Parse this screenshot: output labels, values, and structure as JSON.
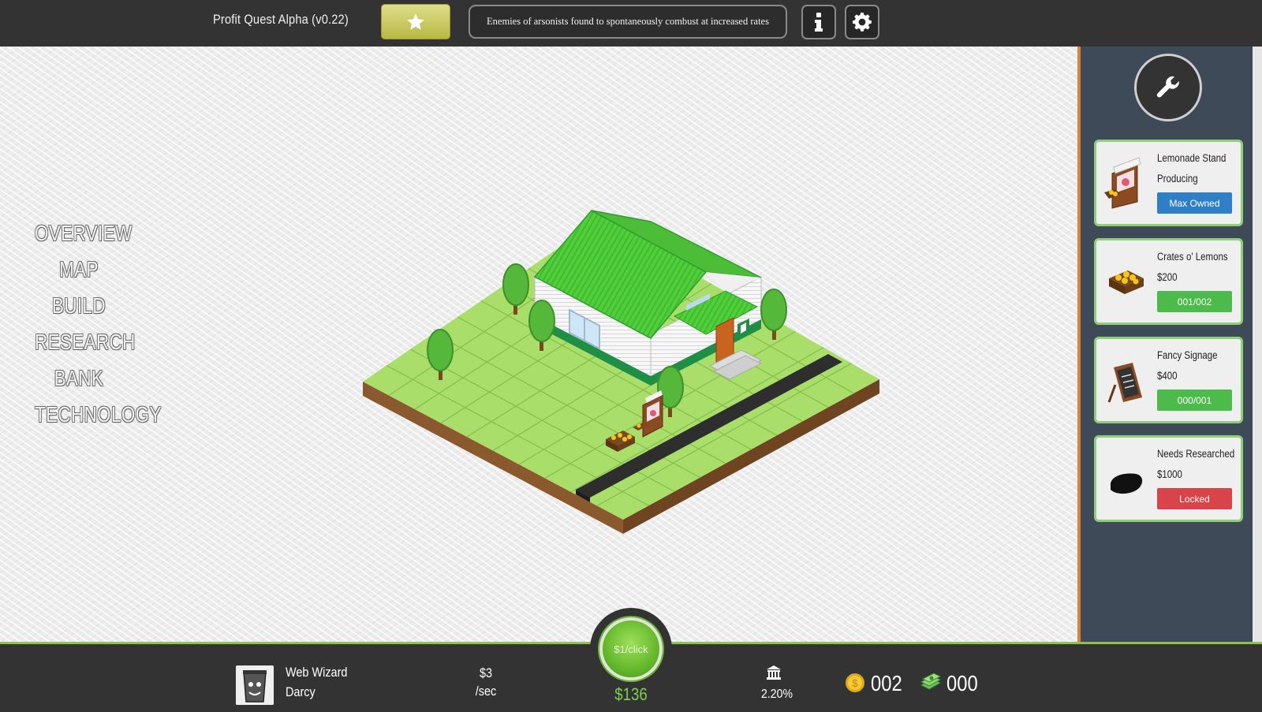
{
  "header": {
    "title": "Profit Quest Alpha (v0.22)",
    "ticker": "Enemies of arsonists found to spontaneously combust at increased rates",
    "icons": {
      "favorite": "star-icon",
      "info": "info-icon",
      "settings": "gear-icon"
    }
  },
  "nav": {
    "items": [
      {
        "label": "OVERVIEW"
      },
      {
        "label": "MAP"
      },
      {
        "label": "BUILD"
      },
      {
        "label": "RESEARCH"
      },
      {
        "label": "BANK"
      },
      {
        "label": "TECHNOLOGY"
      }
    ]
  },
  "sidebar": {
    "tool_icon": "wrench-icon",
    "cards": [
      {
        "title": "Lemonade Stand",
        "subtitle": "Producing",
        "button": "Max Owned",
        "status": "info",
        "icon": "lemonade-stand-icon"
      },
      {
        "title": "Crates o' Lemons",
        "subtitle": "$200",
        "button": "001/002",
        "status": "success",
        "icon": "lemon-crate-icon"
      },
      {
        "title": "Fancy Signage",
        "subtitle": "$400",
        "button": "000/001",
        "status": "success",
        "icon": "chalkboard-sign-icon"
      },
      {
        "title": "Needs Researched",
        "subtitle": "$1000",
        "button": "Locked",
        "status": "danger",
        "icon": "locked-silhouette-icon"
      }
    ]
  },
  "footer": {
    "player_title": "Web Wizard",
    "player_name": "Darcy",
    "rate_amount": "$3",
    "rate_unit": "/sec",
    "click_label": "$1/click",
    "money": "$136",
    "interest_rate": "2.20%",
    "coins": "002",
    "cash": "000"
  },
  "colors": {
    "accent_green": "#8dc04e",
    "button_blue": "#2f7fc6",
    "button_green": "#4cbb4c",
    "button_red": "#d9434a",
    "sidebar_bg": "#3e4a58",
    "sidebar_border": "#d4863a"
  }
}
